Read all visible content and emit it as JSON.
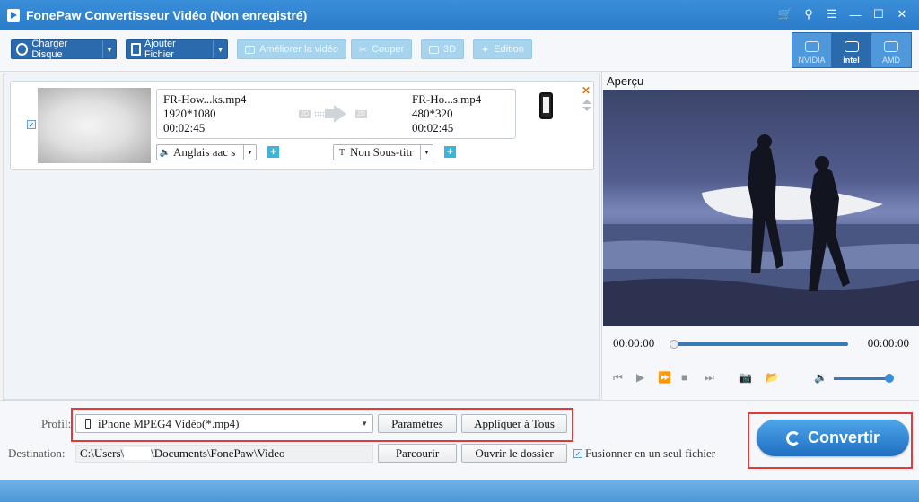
{
  "window": {
    "title": "FonePaw Convertisseur Vidéo (Non enregistré)",
    "controls": [
      "cart-icon",
      "key-icon",
      "feedback-icon",
      "minimize-icon",
      "maximize-icon",
      "close-icon"
    ]
  },
  "toolbar": {
    "charger_disque": "Charger Disque",
    "ajouter_fichier": "Ajouter Fichier",
    "ameliorer": "Améliorer la vidéo",
    "couper": "Couper",
    "three_d": "3D",
    "edition": "Edition",
    "hw_accel": [
      {
        "label": "NVIDIA",
        "active": false
      },
      {
        "label": "intel",
        "active": true
      },
      {
        "label": "AMD",
        "active": false
      }
    ]
  },
  "file_item": {
    "checked": true,
    "source": {
      "name": "FR-How...ks.mp4",
      "resolution": "1920*1080",
      "duration": "00:02:45"
    },
    "output": {
      "name": "FR-Ho...s.mp4",
      "resolution": "480*320",
      "duration": "00:02:45"
    },
    "tag_2d_in": "2D",
    "tag_2d_out": "2D",
    "audio_track": "Anglais aac s",
    "subtitle": "Non Sous-titr"
  },
  "preview": {
    "title": "Aperçu",
    "current_time": "00:00:00",
    "total_time": "00:00:00",
    "progress": 0,
    "volume": 1
  },
  "bottom": {
    "profil_label": "Profil:",
    "profil_value": "iPhone MPEG4 Vidéo(*.mp4)",
    "parametres": "Paramètres",
    "appliquer": "Appliquer à Tous",
    "destination_label": "Destination:",
    "dest_prefix": "C:\\Users\\",
    "dest_suffix": "\\Documents\\FonePaw\\Video",
    "parcourir": "Parcourir",
    "ouvrir": "Ouvrir le dossier",
    "fusionner": "Fusionner en un seul fichier",
    "fusionner_checked": true,
    "convertir": "Convertir"
  },
  "colors": {
    "titlebar": "#2b7cc9",
    "primary_button": "#2c6aae",
    "highlight": "#e03a3a",
    "convert": "#2f86d6"
  }
}
